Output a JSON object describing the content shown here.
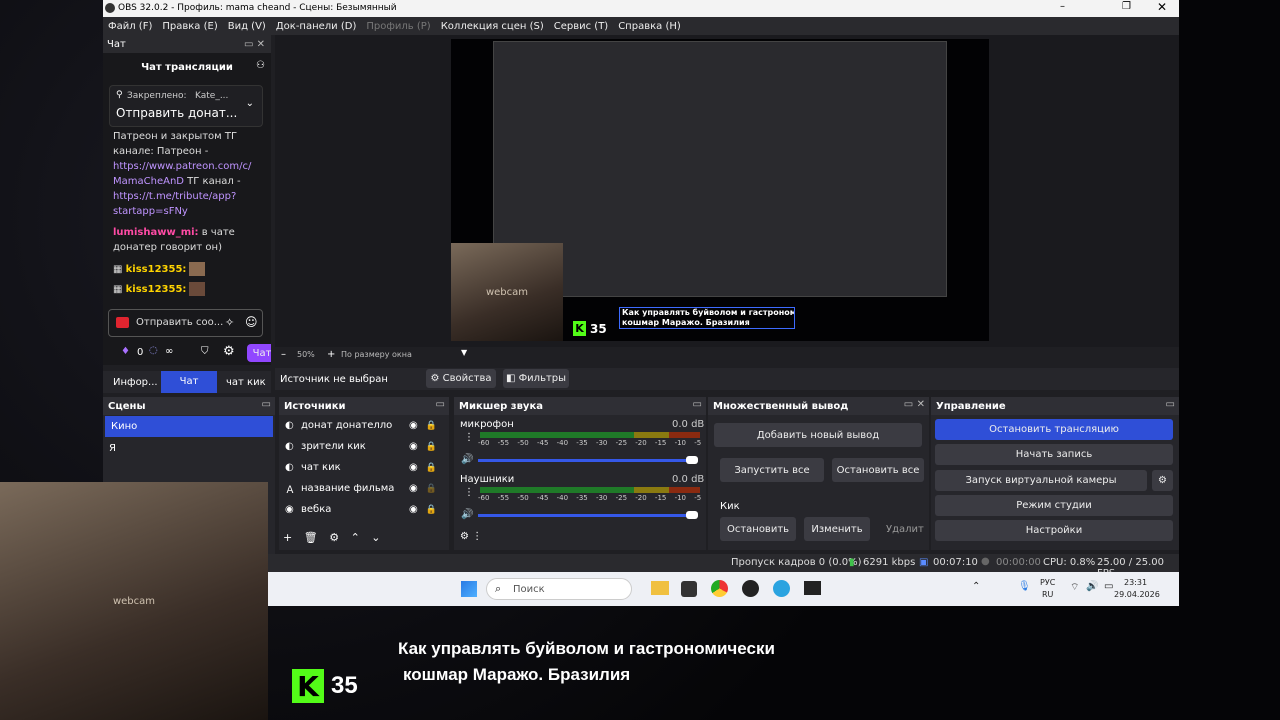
{
  "window": {
    "title": "OBS 32.0.2 - Профиль: mama cheand - Сцены: Безымянный"
  },
  "menu": [
    "Файл (F)",
    "Правка (E)",
    "Вид (V)",
    "Док-панели (D)",
    "Профиль (P)",
    "Коллекция сцен (S)",
    "Сервис (T)",
    "Справка (H)"
  ],
  "chat": {
    "dock_title": "Чат",
    "header": "Чат трансляции",
    "pinned_label": "Закреплено:",
    "pinned_user": "Kate_...",
    "pinned_text": "Отправить донат...",
    "messages": [
      {
        "text": "Патреон и закрытом ТГ"
      },
      {
        "text": "канале: Патреон -"
      },
      {
        "link": "https://www.patreon.com/c/"
      },
      {
        "link": "MamaCheAnD",
        "after": " ТГ канал -"
      },
      {
        "link": "https://t.me/tribute/app?"
      },
      {
        "link": "startapp=sFNy"
      }
    ],
    "msg2_user": "lumishaww_mi:",
    "msg2_text": " в чате",
    "msg2_line2": "донатер говорит он)",
    "kiss1": "kiss12355:",
    "kiss2": "kiss12355:",
    "input_placeholder": "Отправить соо...",
    "points": "0",
    "points_icon": "∞",
    "chat_button": "Чат"
  },
  "tabs": [
    "Инфор...",
    "Чат",
    "чат кик"
  ],
  "preview": {
    "zoom": "50%",
    "fit": "По размеру окна",
    "webcam_label": "webcam",
    "kick_number": "35",
    "caption_line1": "Как управлять буйволом и гастрономически",
    "caption_line2": "кошмар Маражо. Бразилия"
  },
  "source_bar": {
    "none": "Источник не выбран",
    "props": "Свойства",
    "filters": "Фильтры"
  },
  "scenes": {
    "title": "Сцены",
    "items": [
      "Кино",
      "Я"
    ]
  },
  "sources": {
    "title": "Источники",
    "items": [
      "донат донателло",
      "зрители кик",
      "чат кик",
      "название фильма",
      "вебка"
    ]
  },
  "mixer": {
    "title": "Микшер звука",
    "channels": [
      {
        "name": "микрофон",
        "db": "0.0 dB"
      },
      {
        "name": "Наушники",
        "db": "0.0 dB"
      }
    ],
    "ticks": "-60 -55 -50 -45 -40 -35 -30 -25 -20 -15 -10 -5 0"
  },
  "multi": {
    "title": "Множественный вывод",
    "add": "Добавить новый вывод",
    "start_all": "Запустить все",
    "stop_all": "Остановить все",
    "target": "Кик",
    "stop": "Остановить",
    "edit": "Изменить",
    "delete": "Удалит"
  },
  "controls": {
    "title": "Управление",
    "stop_stream": "Остановить трансляцию",
    "record": "Начать запись",
    "vcam": "Запуск виртуальной камеры",
    "studio": "Режим студии",
    "settings": "Настройки"
  },
  "status": {
    "dropped": "Пропуск кадров 0 (0.0%)",
    "kbps": "6291 kbps",
    "live": "00:07:10",
    "rec": "00:00:00",
    "cpu": "CPU: 0.8%",
    "fps": "25.00 / 25.00 FPS"
  },
  "taskbar": {
    "search": "Поиск",
    "lang1": "РУС",
    "lang2": "RU",
    "time": "23:31",
    "date": "29.04.2026"
  },
  "overlay": {
    "webcam_label": "webcam",
    "kick_number": "35",
    "caption_line1": "Как управлять буйволом и гастрономически",
    "caption_line2": "кошмар Маражо. Бразилия"
  }
}
